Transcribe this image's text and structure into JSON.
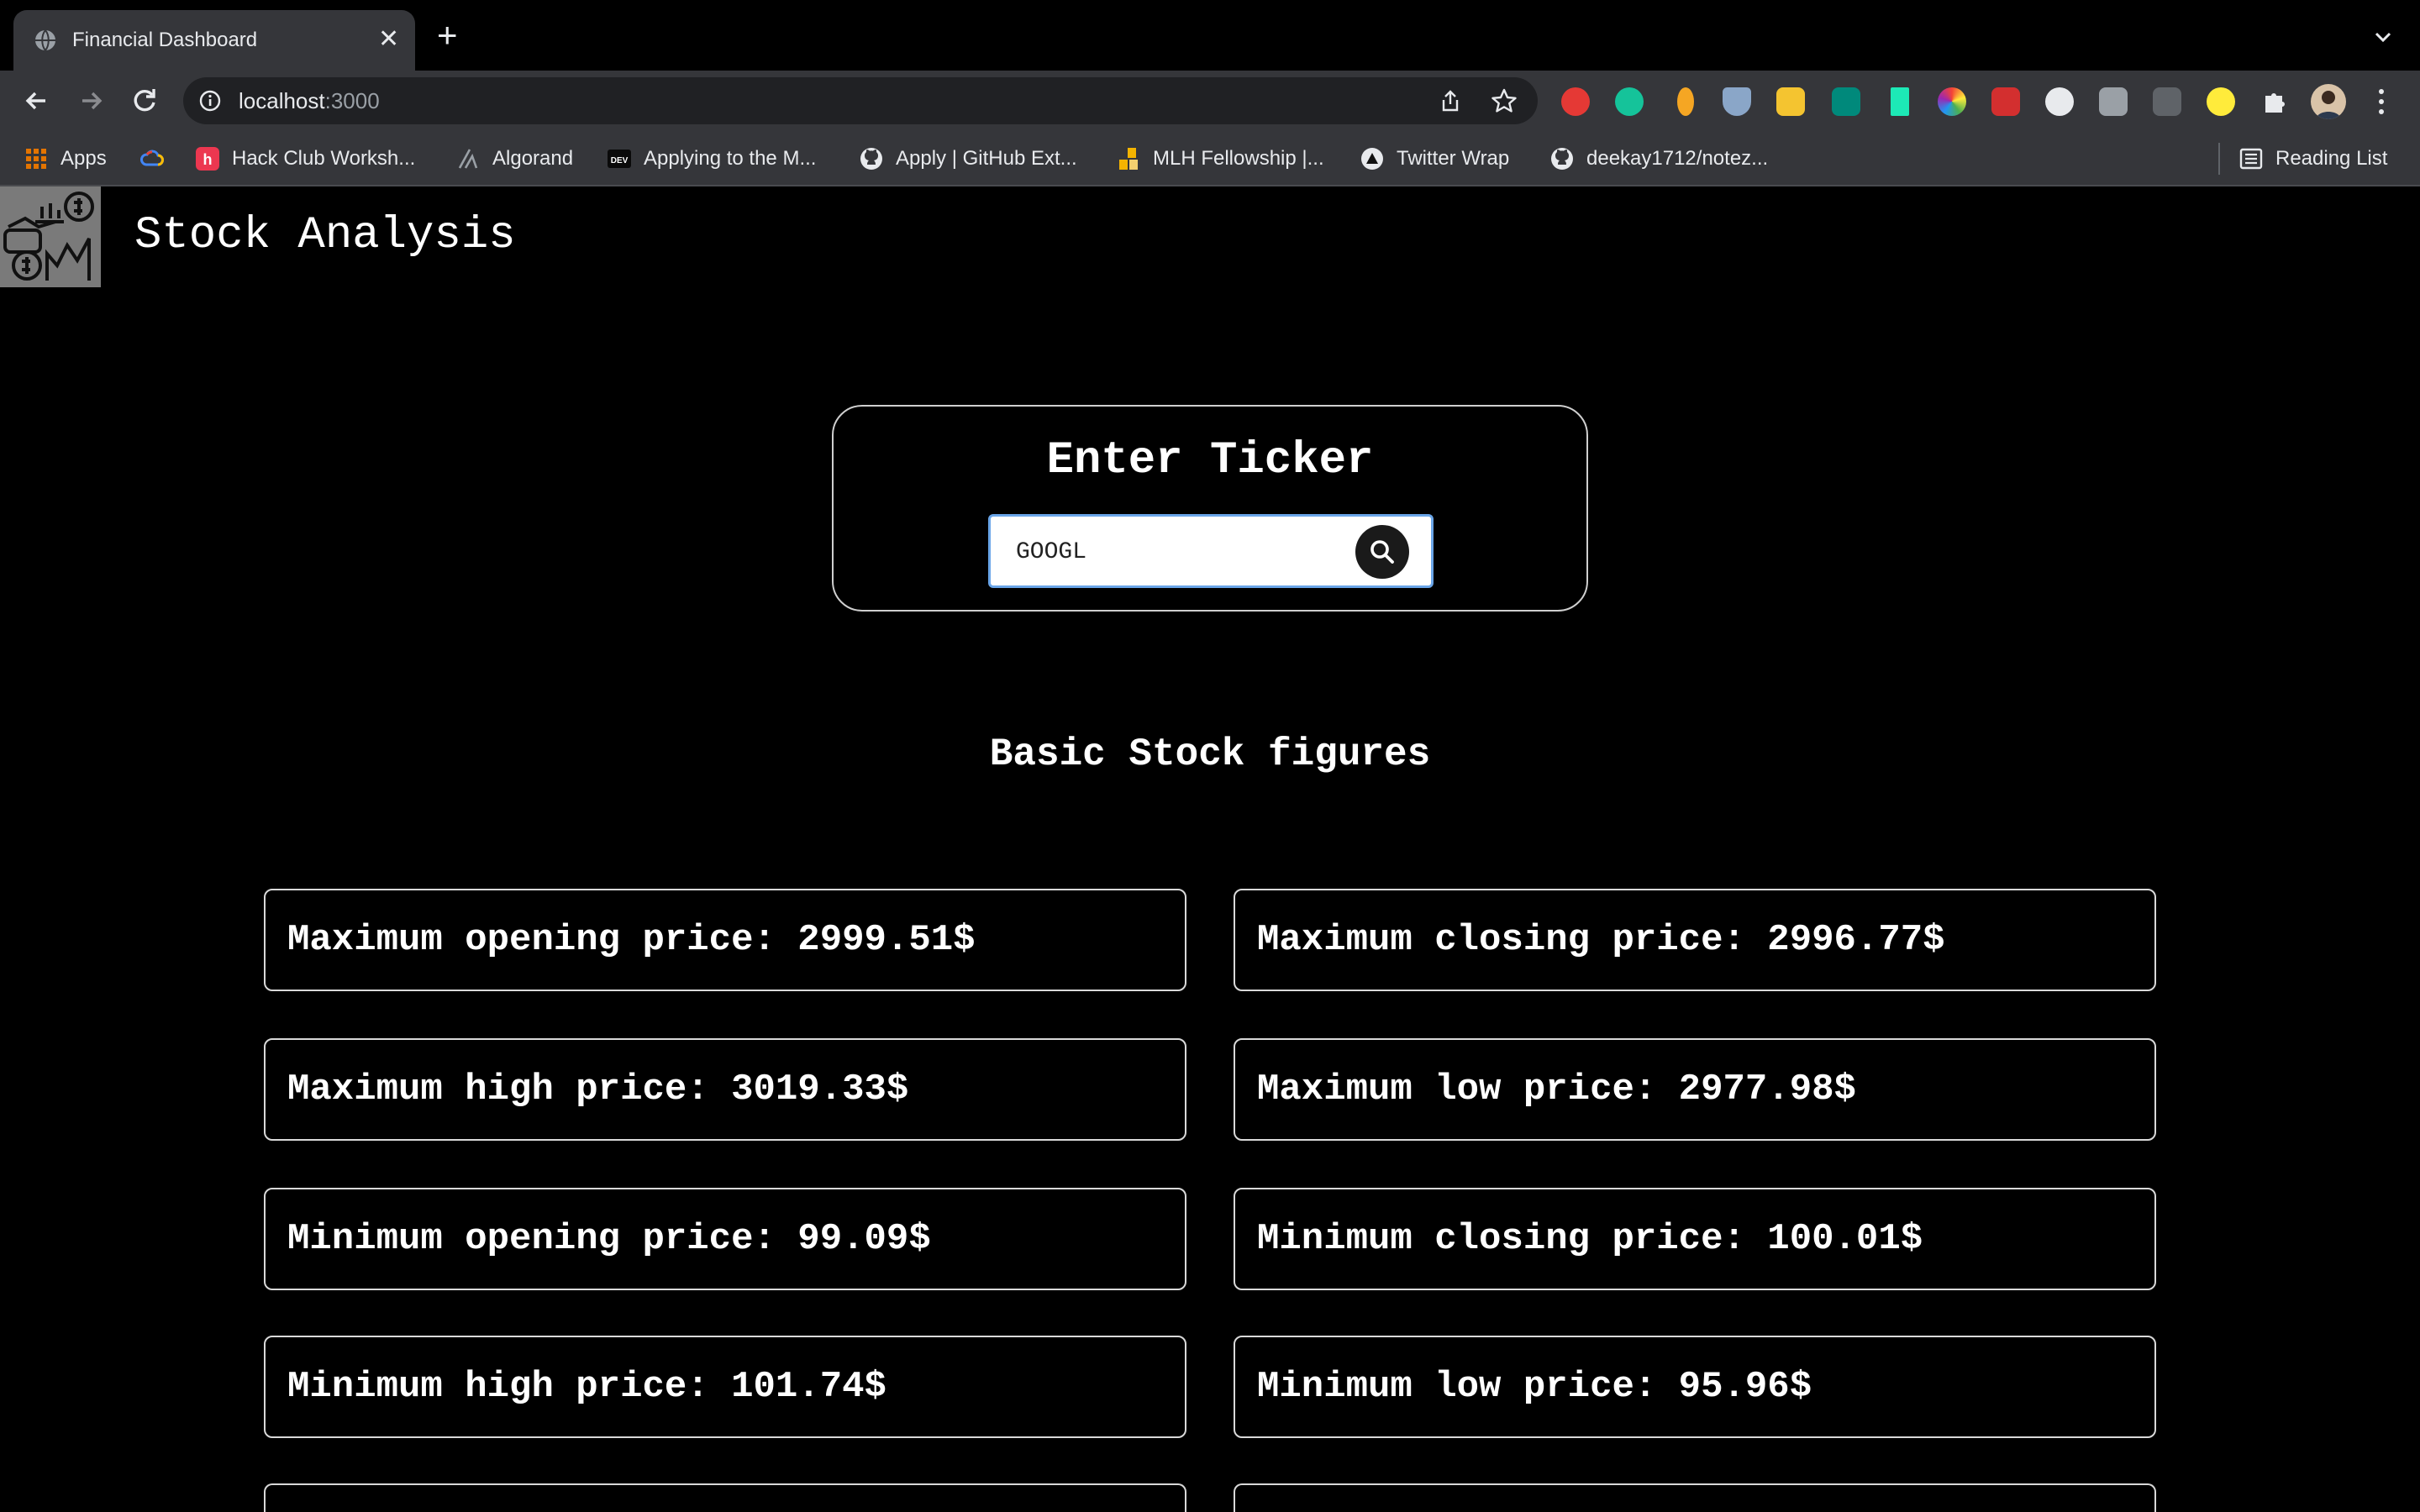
{
  "browser": {
    "tab_title": "Financial Dashboard",
    "tab_close": "✕",
    "new_tab": "+",
    "url_host": "localhost",
    "url_port": ":3000",
    "bookmarks": [
      {
        "label": "Apps",
        "icon": "apps-grid-icon"
      },
      {
        "label": "",
        "icon": "google-cloud-icon"
      },
      {
        "label": "Hack Club Worksh...",
        "icon": "hack-club-icon"
      },
      {
        "label": "Algorand",
        "icon": "algorand-icon"
      },
      {
        "label": "Applying to the M...",
        "icon": "dev-icon"
      },
      {
        "label": "Apply | GitHub Ext...",
        "icon": "github-icon"
      },
      {
        "label": "MLH Fellowship |...",
        "icon": "mlh-icon"
      },
      {
        "label": "Twitter Wrap",
        "icon": "twitter-wrap-icon"
      },
      {
        "label": "deekay1712/notez...",
        "icon": "github-icon"
      }
    ],
    "reading_list": "Reading List"
  },
  "app": {
    "brand": "Stock Analysis",
    "ticker_title": "Enter Ticker",
    "ticker_value": "GOOGL",
    "section_title": "Basic Stock figures",
    "stats": [
      {
        "id": "max-open",
        "label": "Maximum opening price: 2999.51$"
      },
      {
        "id": "max-close",
        "label": "Maximum closing price: 2996.77$"
      },
      {
        "id": "max-high",
        "label": "Maximum high price: 3019.33$"
      },
      {
        "id": "max-low",
        "label": "Maximum low price: 2977.98$"
      },
      {
        "id": "min-open",
        "label": "Minimum opening price: 99.09$"
      },
      {
        "id": "min-close",
        "label": "Minimum closing price: 100.01$"
      },
      {
        "id": "min-high",
        "label": "Minimum high price: 101.74$"
      },
      {
        "id": "min-low",
        "label": "Minimum low price: 95.96$"
      },
      {
        "id": "partial-1",
        "label": ""
      },
      {
        "id": "partial-2",
        "label": ""
      }
    ]
  },
  "colors": {
    "background": "#000000",
    "chrome": "#35363a",
    "card_border": "#d9d9d9",
    "input_focus": "#6aa5e8"
  }
}
